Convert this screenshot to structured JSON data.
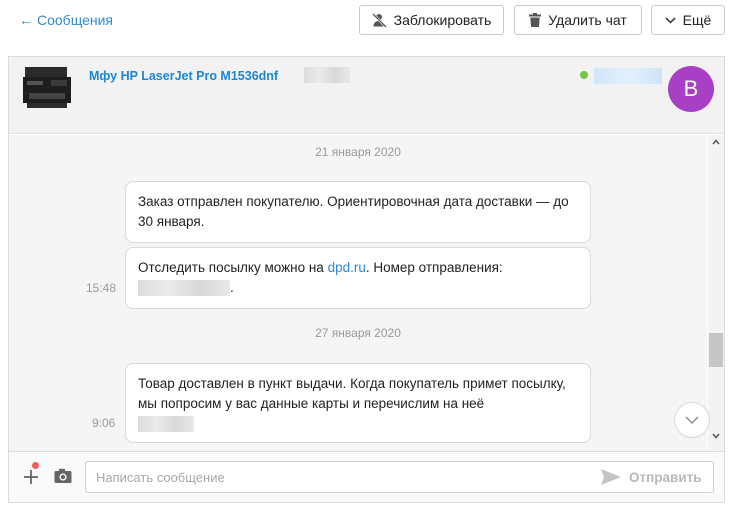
{
  "topbar": {
    "back_label": "Сообщения",
    "block_label": "Заблокировать",
    "delete_label": "Удалить чат",
    "more_label": "Ещё"
  },
  "chat": {
    "product_title": "Мфу HP LaserJet Pro M1536dnf",
    "avatar_letter": "B",
    "accent_color": "#1a87d2",
    "avatar_color": "#a83fc4",
    "online_color": "#77c44a"
  },
  "messages": {
    "date1": "21 января 2020",
    "msg1_text": "Заказ отправлен покупателю. Ориентировочная дата доставки — до 30 января.",
    "msg2_prefix": "Отследить посылку можно на ",
    "msg2_link": "dpd.ru",
    "msg2_suffix": ". Номер отправления:",
    "msg2_end": ".",
    "time2": "15:48",
    "date2": "27 января 2020",
    "msg3_text": "Товар доставлен в пункт выдачи. Когда покупатель примет посылку, мы попросим у вас данные карты и перечислим на неё",
    "time3": "9:06"
  },
  "composer": {
    "placeholder": "Написать сообщение",
    "send_label": "Отправить"
  }
}
